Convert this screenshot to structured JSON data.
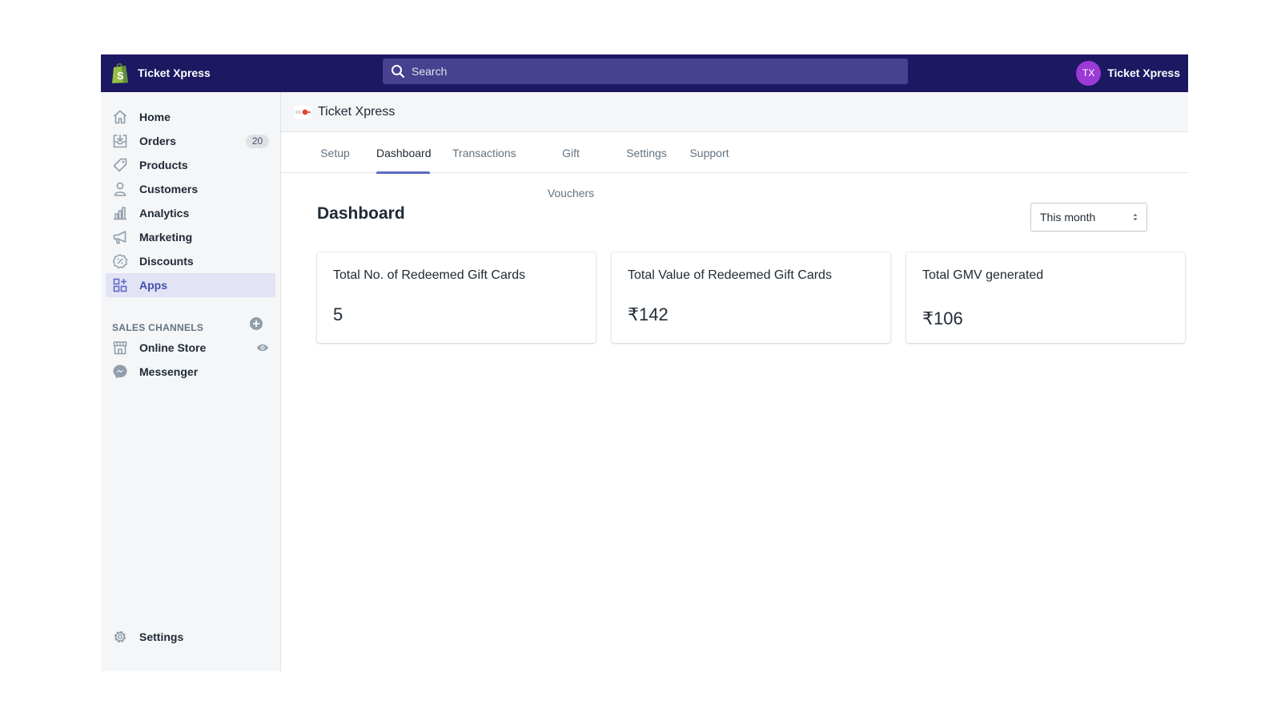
{
  "colors": {
    "topbar": "#1c1862",
    "search_bg": "#47418f",
    "avatar": "#9c3ad6",
    "active_nav": "#e2e3f4",
    "tab_underline": "#5c6ac4",
    "shopify_green": "#95bf47"
  },
  "topbar": {
    "store_name": "Ticket Xpress",
    "logo_icon": "shopify-bag-icon",
    "search_placeholder": "Search",
    "search_icon": "search-icon",
    "user_initials": "TX",
    "user_name": "Ticket Xpress"
  },
  "sidebar": {
    "items": [
      {
        "label": "Home",
        "icon": "home-icon"
      },
      {
        "label": "Orders",
        "icon": "orders-inbox-icon",
        "badge": "20"
      },
      {
        "label": "Products",
        "icon": "tag-icon"
      },
      {
        "label": "Customers",
        "icon": "person-icon"
      },
      {
        "label": "Analytics",
        "icon": "bar-chart-icon"
      },
      {
        "label": "Marketing",
        "icon": "megaphone-icon"
      },
      {
        "label": "Discounts",
        "icon": "discount-badge-icon"
      },
      {
        "label": "Apps",
        "icon": "apps-grid-icon",
        "active": true
      }
    ],
    "sales_channels_title": "SALES CHANNELS",
    "channels": [
      {
        "label": "Online Store",
        "icon": "store-icon",
        "action_icon": "eye-icon"
      },
      {
        "label": "Messenger",
        "icon": "messenger-icon"
      }
    ],
    "settings_label": "Settings"
  },
  "app": {
    "title": "Ticket Xpress",
    "tabs": [
      {
        "label": "Setup"
      },
      {
        "label": "Dashboard",
        "active": true
      },
      {
        "label": "Transactions"
      },
      {
        "label": "Gift Vouchers"
      },
      {
        "label": "Settings"
      },
      {
        "label": "Support"
      }
    ]
  },
  "dashboard": {
    "title": "Dashboard",
    "period_selected": "This month",
    "cards": [
      {
        "label": "Total No. of Redeemed Gift Cards",
        "value": "5"
      },
      {
        "label": "Total Value of Redeemed Gift Cards",
        "value": "₹142"
      },
      {
        "label": "Total GMV generated",
        "value": "₹106"
      }
    ]
  }
}
